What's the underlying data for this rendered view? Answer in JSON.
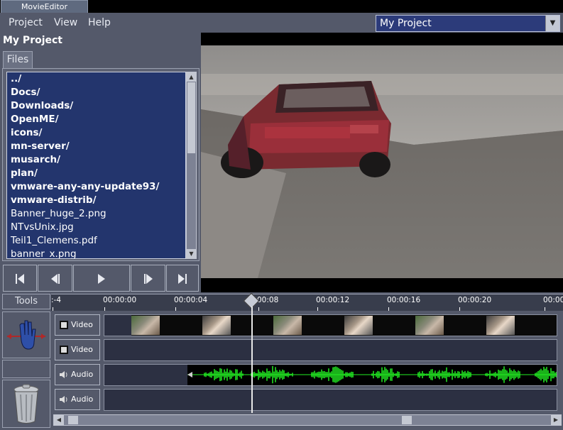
{
  "window": {
    "title": "MovieEditor"
  },
  "menu": {
    "project": "Project",
    "view": "View",
    "help": "Help"
  },
  "project_selector": {
    "value": "My Project"
  },
  "left_panel": {
    "project_title": "My Project",
    "files_tab": "Files",
    "files": [
      {
        "name": "../",
        "dir": true
      },
      {
        "name": "Docs/",
        "dir": true
      },
      {
        "name": "Downloads/",
        "dir": true
      },
      {
        "name": "OpenME/",
        "dir": true
      },
      {
        "name": "icons/",
        "dir": true
      },
      {
        "name": "mn-server/",
        "dir": true
      },
      {
        "name": "musarch/",
        "dir": true
      },
      {
        "name": "plan/",
        "dir": true
      },
      {
        "name": "vmware-any-any-update93/",
        "dir": true
      },
      {
        "name": "vmware-distrib/",
        "dir": true
      },
      {
        "name": "Banner_huge_2.png",
        "dir": false
      },
      {
        "name": "NTvsUnix.jpg",
        "dir": false
      },
      {
        "name": "Teil1_Clemens.pdf",
        "dir": false
      },
      {
        "name": "banner_x.png",
        "dir": false
      }
    ]
  },
  "timeline": {
    "tools_label": "Tools",
    "ruler_labels": [
      ":-4",
      "00:00:00",
      "00:00:04",
      "00:08",
      "00:00:12",
      "00:00:16",
      "00:00:20",
      "00:00:2"
    ],
    "tracks": [
      {
        "label": "Video",
        "kind": "video"
      },
      {
        "label": "Video",
        "kind": "video"
      },
      {
        "label": "Audio",
        "kind": "audio"
      },
      {
        "label": "Audio",
        "kind": "audio"
      }
    ]
  },
  "colors": {
    "accent": "#23356d",
    "panel": "#54596a",
    "waveform": "#22ee22"
  }
}
